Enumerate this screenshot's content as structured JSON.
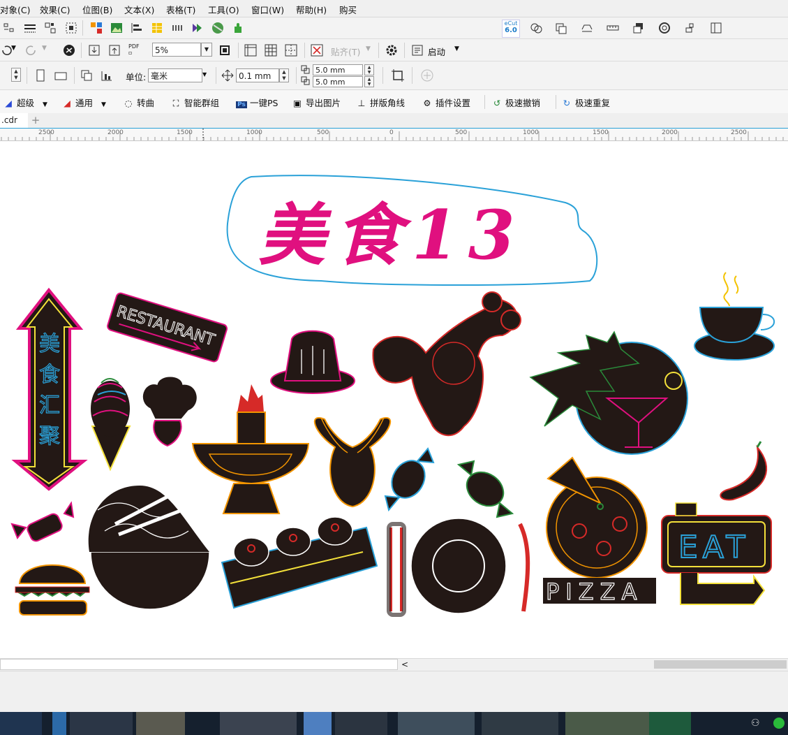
{
  "menu": [
    "对象(C)",
    "效果(C)",
    "位图(B)",
    "文本(X)",
    "表格(T)",
    "工具(O)",
    "窗口(W)",
    "帮助(H)",
    "购买"
  ],
  "toolbar2": {
    "zoom_value": "5%",
    "snap_label": "贴齐(T)",
    "start_label": "启动",
    "pdf_label": "PDF"
  },
  "toolbar3": {
    "unit_label": "单位:",
    "unit_value": "毫米",
    "nudge_value": "0.1 mm",
    "dup_x": "5.0 mm",
    "dup_y": "5.0 mm"
  },
  "plugins": [
    "超级",
    "通用",
    "转曲",
    "智能群组",
    "一键PS",
    "导出图片",
    "拼版角线",
    "插件设置",
    "极速撤销",
    "极速重复"
  ],
  "ecut_badge": {
    "top": "eCut",
    "bottom": "6.0"
  },
  "document_tab": ".cdr",
  "ruler_labels": [
    "2500",
    "2000",
    "1500",
    "1000",
    "500",
    "0",
    "500",
    "1000",
    "1500",
    "2000",
    "2500"
  ],
  "artwork": {
    "title": "美食13",
    "sign_vertical": [
      "美",
      "食",
      "汇",
      "聚"
    ],
    "restaurant": "RESTAURANT",
    "pizza": "PIZZA",
    "eat": "EAT"
  },
  "colors": {
    "title": "#e0107f",
    "bubble": "#2aa1d8",
    "neon_dark": "#231815",
    "accent": "#2aa1d8"
  }
}
